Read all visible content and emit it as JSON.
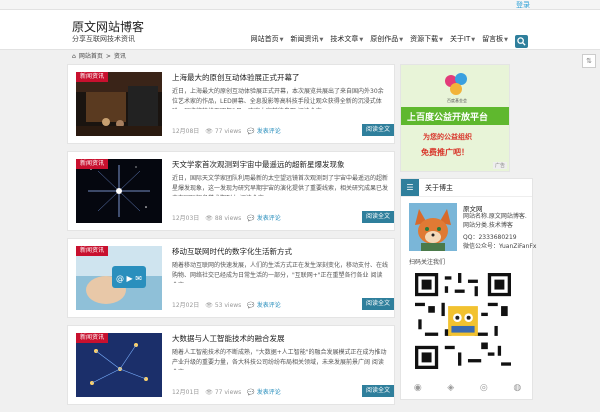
{
  "topbar": {
    "link": "登录"
  },
  "header": {
    "title": "原文网站博客",
    "subtitle": "分享互联网技术资讯",
    "nav": [
      "网站首页",
      "新闻资讯",
      "技术文章",
      "原创作品",
      "资源下载",
      "关于IT",
      "留言板"
    ],
    "search_icon": "search-icon"
  },
  "breadcrumb": {
    "home": "网站首页",
    "sep": ">",
    "current": "资讯"
  },
  "posts": [
    {
      "cat": "新闻资讯",
      "title": "上海最大的原创互动体验展正式开幕了",
      "excerpt": "近日，上海最大的原创互动体验展正式开幕，本次展览共展出了来自国内外30余位艺术家的作品，LED屏幕、全息投影等高科技手段让观众获得全新的沉浸式体验，展览将持续至明年2月，欢迎大家前往参观 阅读全文...",
      "date": "12月08日",
      "views": "77 views",
      "comments": "发表评论",
      "more": "阅读全文"
    },
    {
      "cat": "新闻资讯",
      "title": "天文学家首次观测到宇宙中最遥远的超新星爆发现象",
      "excerpt": "近日，国际天文学家团队利用最新的太空望远镜首次观测到了宇宙中最遥远的超新星爆发现象，这一发现为研究早期宇宙的演化提供了重要线索，相关研究成果已发表在国际知名学术期刊上 阅读全文...",
      "date": "12月03日",
      "views": "88 views",
      "comments": "发表评论",
      "more": "阅读全文"
    },
    {
      "cat": "新闻资讯",
      "title": "移动互联网时代的数字化生活新方式",
      "excerpt": "随着移动互联网的快速发展，人们的生活方式正在发生深刻变化，移动支付、在线购物、网络社交已经成为日常生活的一部分，\"互联网+\"正在重塑各行各业 阅读全文...",
      "date": "12月02日",
      "views": "53 views",
      "comments": "发表评论",
      "more": "阅读全文"
    },
    {
      "cat": "新闻资讯",
      "title": "大数据与人工智能技术的融合发展",
      "excerpt": "随着人工智能技术的不断成熟，\"大数据+人工智能\"的融合发展模式正在成为推动产业升级的重要力量，各大科技公司纷纷布局相关领域，未来发展前景广阔 阅读全文...",
      "date": "12月01日",
      "views": "77 views",
      "comments": "发表评论",
      "more": "阅读全文"
    }
  ],
  "ad": {
    "line1": "上百度公益开放平台",
    "line2": "为您的公益组织",
    "line3": "免费推广吧！",
    "label": "广告",
    "brand": "百度基金会"
  },
  "about": {
    "header": "关于博主",
    "name": "原文网",
    "desc1": "网站名称.原文网站博客.",
    "desc2": "网站分类.技术博客",
    "qq": "QQ：2333680219",
    "wechat": "微信公众号：YuanZiFanFx",
    "scan": "扫码关注我们"
  },
  "social_icons": [
    "wechat-icon",
    "qq-icon",
    "weibo-icon",
    "rss-icon"
  ],
  "colors": {
    "accent": "#2f7f9c",
    "category": "#c8102e",
    "link": "#2a8fbd"
  }
}
